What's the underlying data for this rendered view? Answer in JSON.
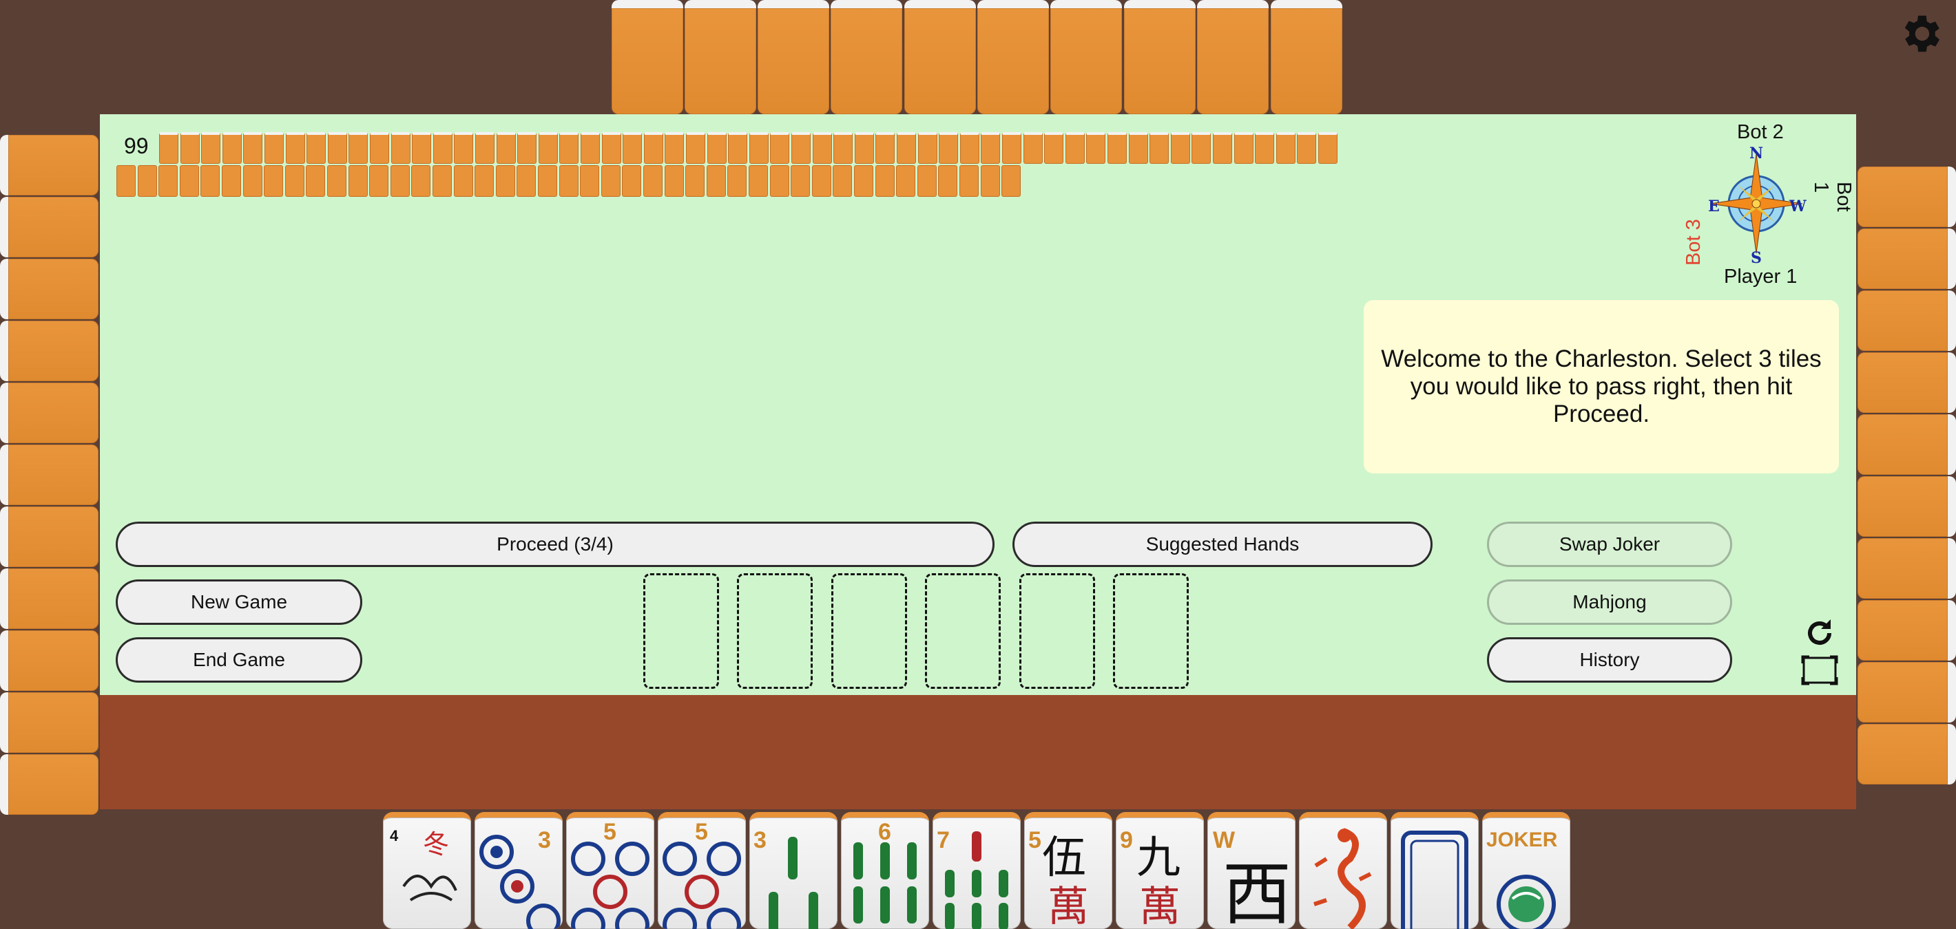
{
  "wall": {
    "count": "99"
  },
  "compass": {
    "top_seat": "Bot 2",
    "left_seat": "Bot 3",
    "right_seat": "Bot 1",
    "bottom_seat": "Player 1",
    "north": "N",
    "south": "S",
    "east": "E",
    "west": "W"
  },
  "message": "Welcome to the Charleston. Select 3 tiles you would like to pass right, then hit Proceed.",
  "buttons": {
    "proceed": "Proceed (3/4)",
    "suggested_hands": "Suggested Hands",
    "swap_joker": "Swap Joker",
    "new_game": "New Game",
    "mahjong": "Mahjong",
    "end_game": "End Game",
    "history": "History"
  },
  "hand": [
    {
      "suit": "flower",
      "label": "4"
    },
    {
      "suit": "dot",
      "label": "3"
    },
    {
      "suit": "dot",
      "label": "5"
    },
    {
      "suit": "dot",
      "label": "5"
    },
    {
      "suit": "bam",
      "label": "3"
    },
    {
      "suit": "bam",
      "label": "6"
    },
    {
      "suit": "bam",
      "label": "7"
    },
    {
      "suit": "crak",
      "label": "5"
    },
    {
      "suit": "crak",
      "label": "9"
    },
    {
      "suit": "wind",
      "label": "W"
    },
    {
      "suit": "dragon",
      "label": ""
    },
    {
      "suit": "soap",
      "label": ""
    },
    {
      "suit": "joker",
      "label": "JOKER"
    }
  ],
  "colors": {
    "table": "#cff5cc",
    "rack": "#98482a",
    "tile_back": "#e8923a",
    "message_bg": "#fefdd6",
    "bot3": "#e0432f"
  },
  "icons": [
    "gear-icon",
    "compass-icon",
    "refresh-icon",
    "fullscreen-icon"
  ]
}
